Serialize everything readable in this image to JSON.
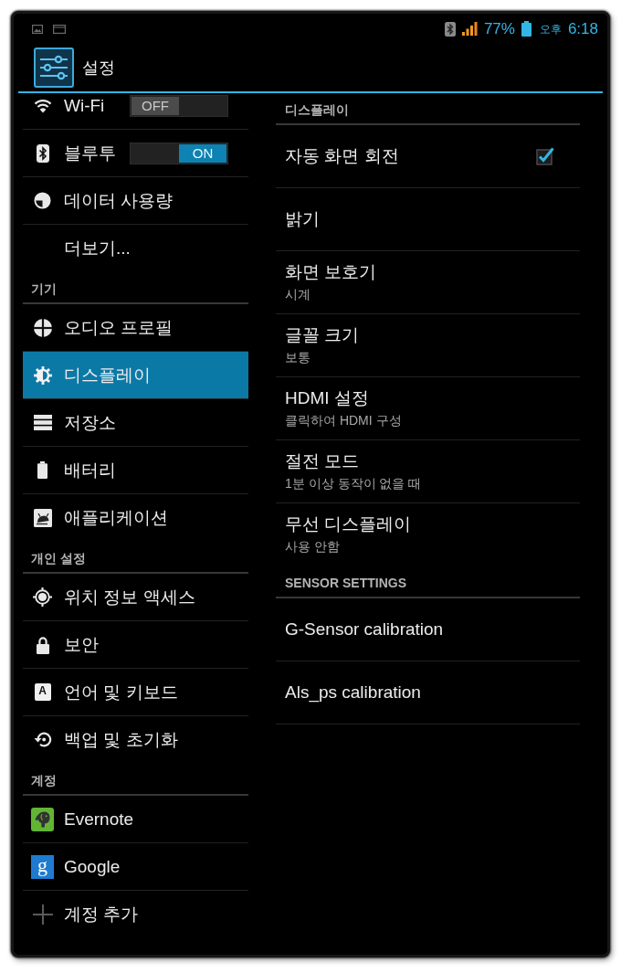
{
  "status_bar": {
    "battery_percent": "77%",
    "time_period": "오후",
    "time": "6:18"
  },
  "action_bar": {
    "title": "설정"
  },
  "sidebar": {
    "groups": [
      {
        "items": [
          {
            "label": "Wi-Fi",
            "kind": "toggle",
            "on": false,
            "switch_label": "OFF",
            "selected": false
          },
          {
            "label": "블루투",
            "kind": "toggle",
            "on": true,
            "switch_label": "ON",
            "selected": false
          },
          {
            "label": "데이터 사용량",
            "kind": "item",
            "selected": false
          },
          {
            "label": "더보기...",
            "kind": "item",
            "selected": false
          }
        ]
      },
      {
        "header": "기기",
        "items": [
          {
            "label": "오디오 프로필",
            "kind": "item",
            "selected": false
          },
          {
            "label": "디스플레이",
            "kind": "item",
            "selected": true
          },
          {
            "label": "저장소",
            "kind": "item",
            "selected": false
          },
          {
            "label": "배터리",
            "kind": "item",
            "selected": false
          },
          {
            "label": "애플리케이션",
            "kind": "item",
            "selected": false
          }
        ]
      },
      {
        "header": "개인 설정",
        "items": [
          {
            "label": "위치 정보 액세스",
            "kind": "item",
            "selected": false
          },
          {
            "label": "보안",
            "kind": "item",
            "selected": false
          },
          {
            "label": "언어 및 키보드",
            "kind": "item",
            "selected": false,
            "icon_text": "A"
          },
          {
            "label": "백업 및 초기화",
            "kind": "item",
            "selected": false
          }
        ]
      },
      {
        "header": "계정",
        "items": [
          {
            "label": "Evernote",
            "kind": "item",
            "selected": false
          },
          {
            "label": "Google",
            "kind": "item",
            "selected": false,
            "icon_text": "g"
          },
          {
            "label": "계정 추가",
            "kind": "item",
            "selected": false
          }
        ]
      }
    ]
  },
  "detail": {
    "sections": [
      {
        "header": "디스플레이",
        "items": [
          {
            "title": "자동 화면 회전",
            "kind": "checkbox",
            "checked": true
          },
          {
            "title": "밝기",
            "kind": "plain"
          },
          {
            "title": "화면 보호기",
            "summary": "시계",
            "kind": "plain"
          },
          {
            "title": "글꼴 크기",
            "summary": "보통",
            "kind": "plain"
          },
          {
            "title": "HDMI 설정",
            "summary": "클릭하여 HDMI 구성",
            "kind": "plain"
          },
          {
            "title": "절전 모드",
            "summary": "1분 이상 동작이 없을 때",
            "kind": "plain"
          },
          {
            "title": "무선 디스플레이",
            "summary": "사용 안함",
            "kind": "plain"
          }
        ]
      },
      {
        "header": "SENSOR SETTINGS",
        "items": [
          {
            "title": "G-Sensor calibration",
            "kind": "plain"
          },
          {
            "title": "Als_ps calibration",
            "kind": "plain"
          }
        ]
      }
    ]
  }
}
